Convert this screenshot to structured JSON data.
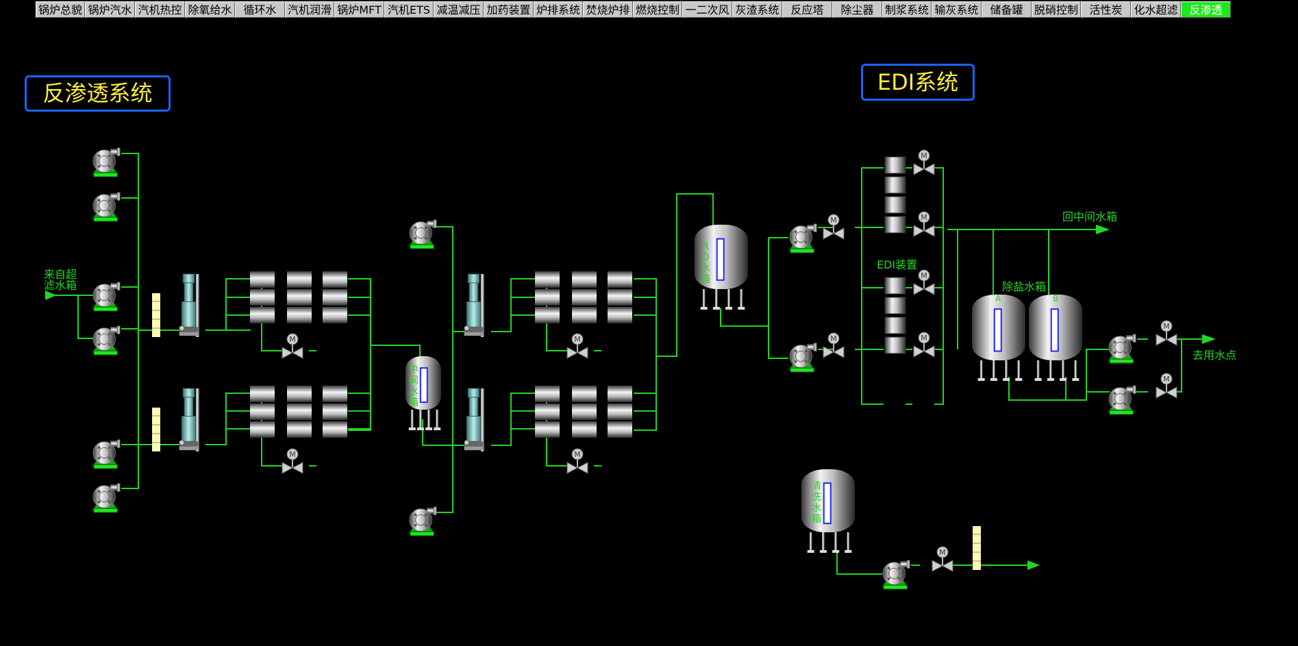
{
  "nav": {
    "tabs": [
      {
        "label": "锅炉总貌",
        "active": false
      },
      {
        "label": "锅炉汽水",
        "active": false
      },
      {
        "label": "汽机热控",
        "active": false
      },
      {
        "label": "除氧给水",
        "active": false
      },
      {
        "label": "循环水",
        "active": false
      },
      {
        "label": "汽机润滑",
        "active": false
      },
      {
        "label": "锅炉MFT",
        "active": false
      },
      {
        "label": "汽机ETS",
        "active": false
      },
      {
        "label": "减温减压",
        "active": false
      },
      {
        "label": "加药装置",
        "active": false
      },
      {
        "label": "炉排系统",
        "active": false
      },
      {
        "label": "焚烧炉排",
        "active": false
      },
      {
        "label": "燃烧控制",
        "active": false
      },
      {
        "label": "一二次风",
        "active": false
      },
      {
        "label": "灰渣系统",
        "active": false
      },
      {
        "label": "反应塔",
        "active": false
      },
      {
        "label": "除尘器",
        "active": false
      },
      {
        "label": "制浆系统",
        "active": false
      },
      {
        "label": "输灰系统",
        "active": false
      },
      {
        "label": "储备罐",
        "active": false
      },
      {
        "label": "脱硝控制",
        "active": false
      },
      {
        "label": "活性炭",
        "active": false
      },
      {
        "label": "化水超滤",
        "active": false
      },
      {
        "label": "反渗透",
        "active": true
      }
    ]
  },
  "titles": {
    "ro_system": "反渗透系统",
    "edi_system": "EDI系统"
  },
  "labels": {
    "inlet_line1": "来自超",
    "inlet_line2": "滤水箱",
    "edi_device": "EDI装置",
    "return_intermediate": "回中间水箱",
    "desalted_tank": "除盐水箱",
    "tank_a": "A",
    "tank_b": "B",
    "to_use_point": "去用水点",
    "intermediate_tank": [
      "中",
      "间",
      "水",
      "箱"
    ],
    "ro_tank": [
      "R",
      "O",
      "水",
      "箱"
    ],
    "cleaning_tank": [
      "清",
      "洗",
      "水",
      "箱"
    ]
  },
  "colors": {
    "pipe": "#21d821",
    "title_border": "#1565ff",
    "title_text": "#ffeb3b",
    "active_tab": "#1fe81f",
    "level_bar": "#2626ff"
  }
}
